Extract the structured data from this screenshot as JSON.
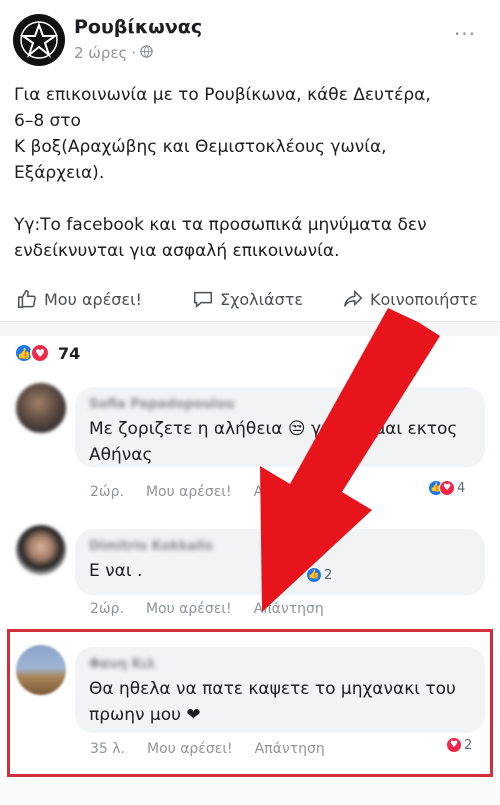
{
  "post": {
    "page_name": "Ρουβίκωνας",
    "time": "2 ώρες",
    "dot": "·",
    "more": "...",
    "text": "Για επικοινωνία με το Ρουβίκωνα, κάθε Δευτέρα,\n6–8 στο\nΚ βοξ(Αραχώβης και Θεμιστοκλέους γωνία,\nΕξάρχεια).\n\nΥγ:Το facebook και τα προσωπικά μηνύματα δεν\nενδείκνυνται για ασφαλή επικοινωνία."
  },
  "actions": {
    "like": "Μου αρέσει!",
    "comment": "Σχολιάστε",
    "share": "Κοινοποιήστε"
  },
  "reactions": {
    "count": "74"
  },
  "comments": [
    {
      "name": "Sofia Papadopoulou",
      "text": "Με ζοριζετε η αλήθεια 😒 γιατί είμαι εκτος Αθήνας",
      "time": "2ώρ.",
      "like": "Μου αρέσει!",
      "reply": "Απάντηση",
      "react_count": "4"
    },
    {
      "name": "Dimitris Kokkalis",
      "text": "Ε ναι .",
      "time": "2ώρ.",
      "like": "Μου αρέσει!",
      "reply": "Απάντηση",
      "react_count": "2"
    },
    {
      "name": "Φανη Κιλ",
      "text": "Θα ηθελα να πατε καψετε το μηχανακι του πρωην μου ❤",
      "time": "35 λ.",
      "like": "Μου αρέσει!",
      "reply": "Απάντηση",
      "react_count": "2"
    }
  ],
  "colors": {
    "accent": "#1877f2",
    "highlight": "#d32f3a",
    "arrow": "#e8141c"
  }
}
